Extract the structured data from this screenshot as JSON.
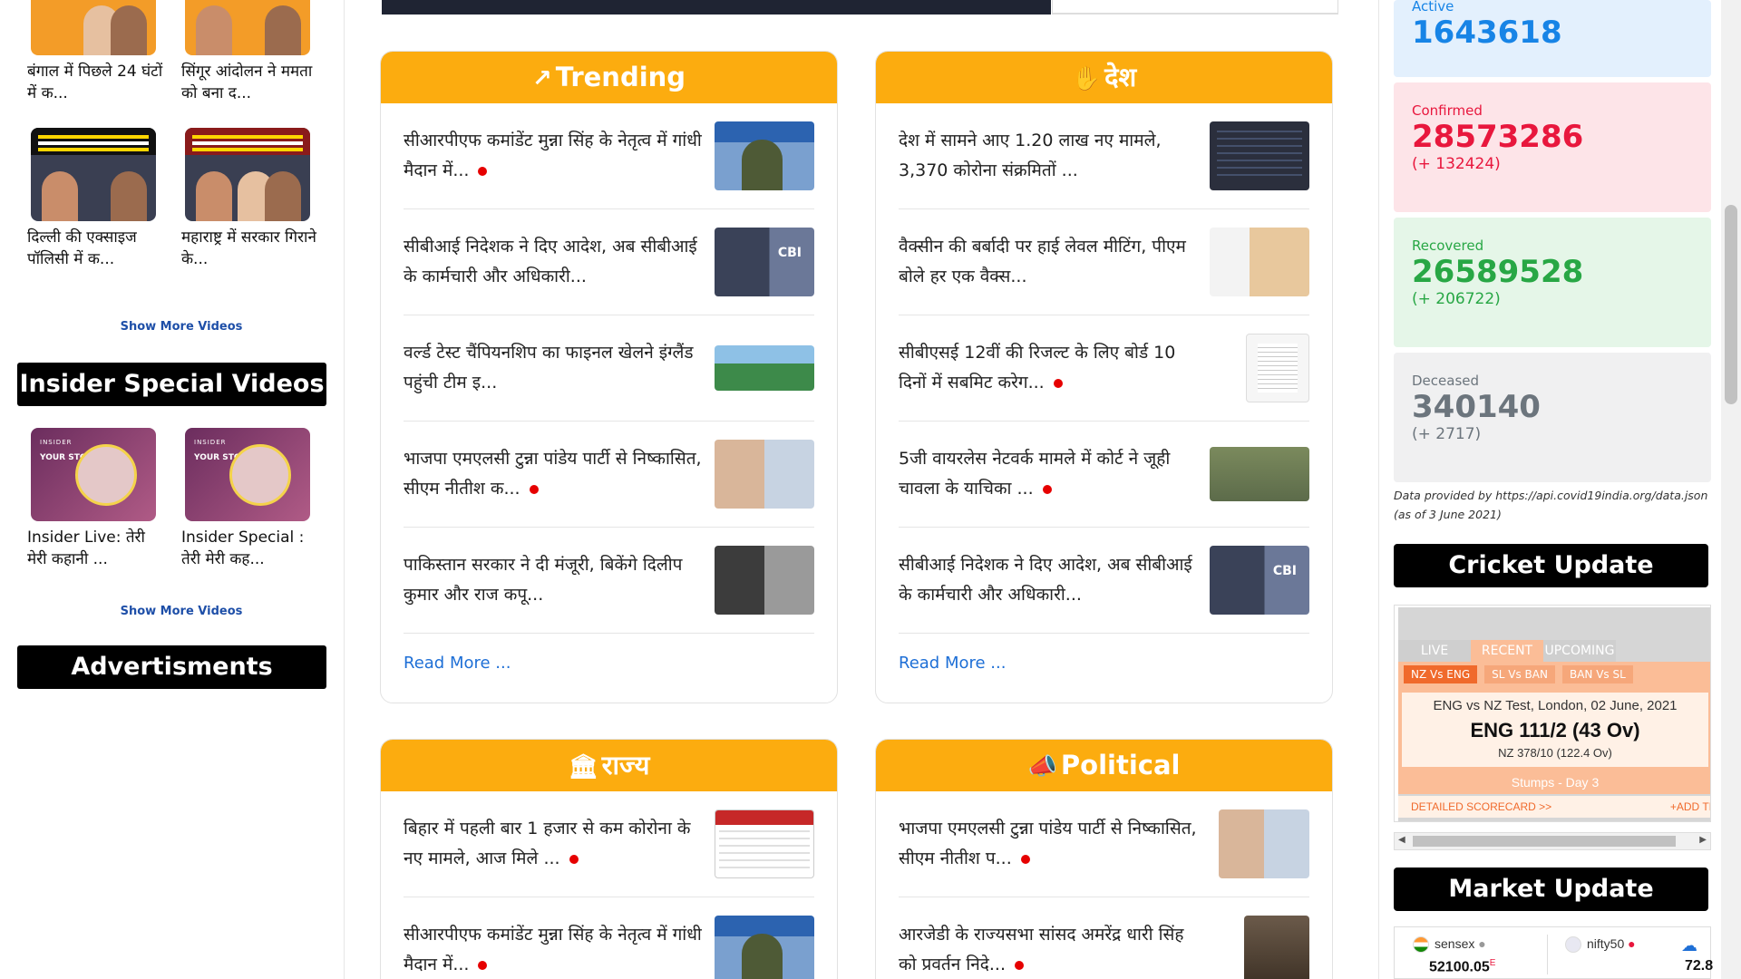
{
  "left": {
    "videos_top": [
      {
        "title": "बंगाल में पिछले 24 घंटों में क..."
      },
      {
        "title": "सिंगूर आंदोलन ने ममता को बना द..."
      },
      {
        "title": "दिल्ली की एक्साइज पॉलिसी में क..."
      },
      {
        "title": "महाराष्ट्र में सरकार गिराने के..."
      }
    ],
    "show_more_1": "Show More Videos",
    "special_heading": "Insider Special Videos",
    "special_videos": [
      {
        "title": "Insider Live: तेरी मेरी कहानी ...",
        "thumb_brand": "INSIDER",
        "thumb_text": "YOUR STORY"
      },
      {
        "title": "Insider Special : तेरी मेरी कह...",
        "thumb_brand": "INSIDER",
        "thumb_text": "YOUR STORY"
      }
    ],
    "show_more_2": "Show More Videos",
    "ads_heading": "Advertisments"
  },
  "trending": {
    "title": "Trending",
    "icon": "trending-up-icon",
    "items": [
      {
        "text": "सीआरपीएफ कमांडेंट मुन्ना सिंह के नेतृत्व में गांधी मैदान में...",
        "live": true
      },
      {
        "text": "सीबीआई निदेशक ने दिए आदेश, अब सीबीआई के कार्मचारी और अधिकारी...",
        "live": false
      },
      {
        "text": "वर्ल्ड टेस्ट चैंपियनशिप का फाइनल खेलने इंग्लैंड पहुंची टीम इ...",
        "live": false
      },
      {
        "text": "भाजपा एमएलसी टुन्ना पांडेय पार्टी से निष्कासित, सीएम नीतीश क...",
        "live": true
      },
      {
        "text": "पाकिस्तान सरकार ने दी मंजूरी, बिकेंगे दिलीप कुमार और राज कपू...",
        "live": false
      }
    ],
    "read_more": "Read More ..."
  },
  "desh": {
    "title": "देश",
    "icon": "india-map-icon",
    "items": [
      {
        "text": "देश में सामने आए 1.20 लाख नए मामले, 3,370 कोरोना संक्रमितों ...",
        "live": false
      },
      {
        "text": "वैक्सीन की बर्बादी पर हाई लेवल मीटिंग, पीएम बोले हर एक वैक्स...",
        "live": false
      },
      {
        "text": "सीबीएसई 12वीं की रिजल्ट के लिए बोर्ड 10 दिनों में सबमिट करेग...",
        "live": true
      },
      {
        "text": "5जी वायरलेस नेटवर्क मामले में कोर्ट ने जूही चावला के याचिका ...",
        "live": true
      },
      {
        "text": "सीबीआई निदेशक ने दिए आदेश, अब सीबीआई के कार्मचारी और अधिकारी...",
        "live": false
      }
    ],
    "read_more": "Read More ..."
  },
  "rajya": {
    "title": "राज्य",
    "icon": "government-building-icon",
    "items": [
      {
        "text": "बिहार में पहली बार 1 हजार से कम कोरोना के नए मामले, आज मिले ...",
        "live": true
      },
      {
        "text": "सीआरपीएफ कमांडेंट मुन्ना सिंह के नेतृत्व में गांधी मैदान में...",
        "live": true
      }
    ]
  },
  "political": {
    "title": "Political",
    "icon": "megaphone-icon",
    "items": [
      {
        "text": "भाजपा एमएलसी टुन्ना पांडेय पार्टी से निष्कासित, सीएम नीतीश प...",
        "live": true
      },
      {
        "text": "आरजेडी के राज्यसभा सांसद अमरेंद्र धारी सिंह को प्रवर्तन निदे...",
        "live": true
      }
    ]
  },
  "covid": {
    "active_label": "Active",
    "active_value": "1643618",
    "confirmed_label": "Confirmed",
    "confirmed_value": "28573286",
    "confirmed_delta": "(+ 132424)",
    "recovered_label": "Recovered",
    "recovered_value": "26589528",
    "recovered_delta": "(+ 206722)",
    "deceased_label": "Deceased",
    "deceased_value": "340140",
    "deceased_delta": "(+ 2717)",
    "source": "Data provided by https://api.covid19india.org/data.json",
    "as_of": "(as of 3 June 2021)"
  },
  "cricket": {
    "heading": "Cricket Update",
    "tabs": [
      "LIVE",
      "RECENT",
      "UPCOMING"
    ],
    "active_tab": "RECENT",
    "matches": [
      "NZ Vs ENG",
      "SL Vs BAN",
      "BAN Vs SL"
    ],
    "info": "ENG vs NZ Test, London, 02 June, 2021",
    "score": "ENG 111/2 (43 Ov)",
    "opponent": "NZ 378/10 (122.4 Ov)",
    "status": "Stumps - Day 3",
    "detailed": "DETAILED SCORECARD >>",
    "add": "+ADD TI"
  },
  "market": {
    "heading": "Market Update",
    "sensex_label": "sensex",
    "sensex_value": "52100.05",
    "sensex_suffix": "E",
    "nifty_label": "nifty50",
    "third_value": "72.8"
  },
  "colors": {
    "accent": "#fcac0f",
    "active": "#1784e6",
    "confirmed": "#e8173d",
    "recovered": "#28a745",
    "deceased": "#6c757d",
    "link": "#1e6fd6"
  }
}
